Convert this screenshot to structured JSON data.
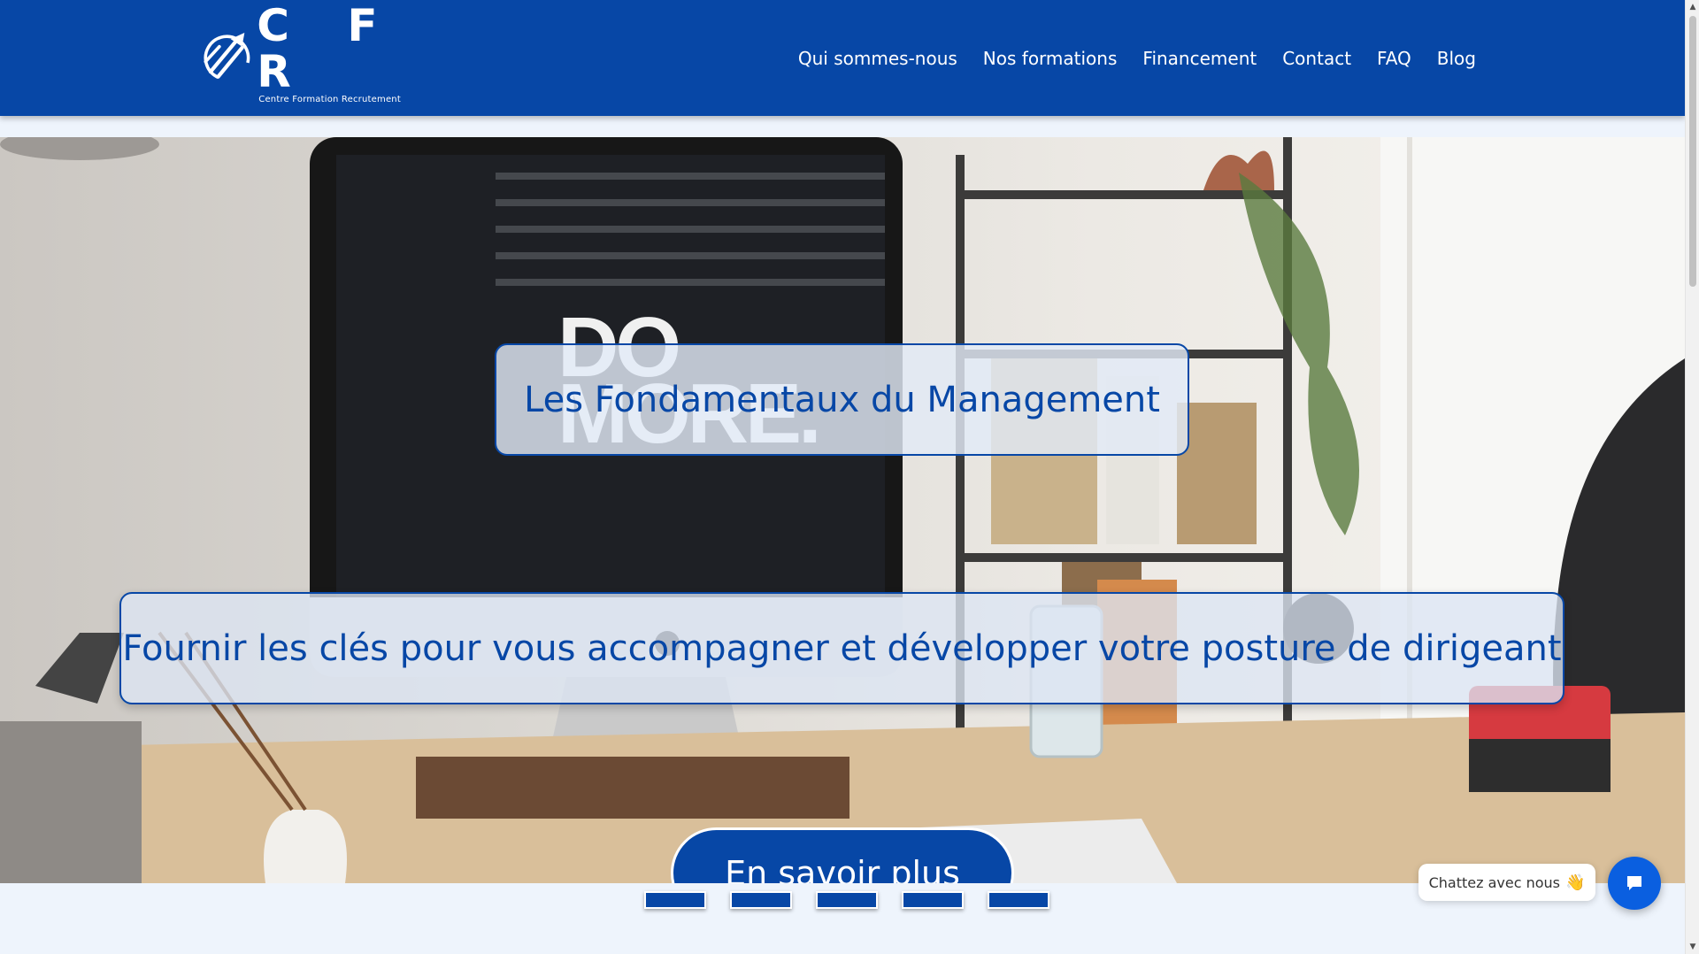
{
  "header": {
    "logo": {
      "letters": "C F R",
      "tagline": "Centre Formation Recrutement"
    },
    "nav": [
      {
        "label": "Qui sommes-nous"
      },
      {
        "label": "Nos formations"
      },
      {
        "label": "Financement"
      },
      {
        "label": "Contact"
      },
      {
        "label": "FAQ"
      },
      {
        "label": "Blog"
      }
    ]
  },
  "hero": {
    "title": "Les Fondamentaux du Management",
    "subtitle": "Fournir les clés pour vous accompagner et développer votre posture de dirigeant",
    "cta_label": "En savoir plus",
    "poster_text": "DO MORE.",
    "slide_indicator_count": 5
  },
  "chat": {
    "label": "Chattez avec nous",
    "icon": "chat-bubble-icon"
  },
  "colors": {
    "brand_blue": "#0747a6",
    "chat_blue": "#0a5fe0",
    "page_background": "#eef4fc"
  }
}
